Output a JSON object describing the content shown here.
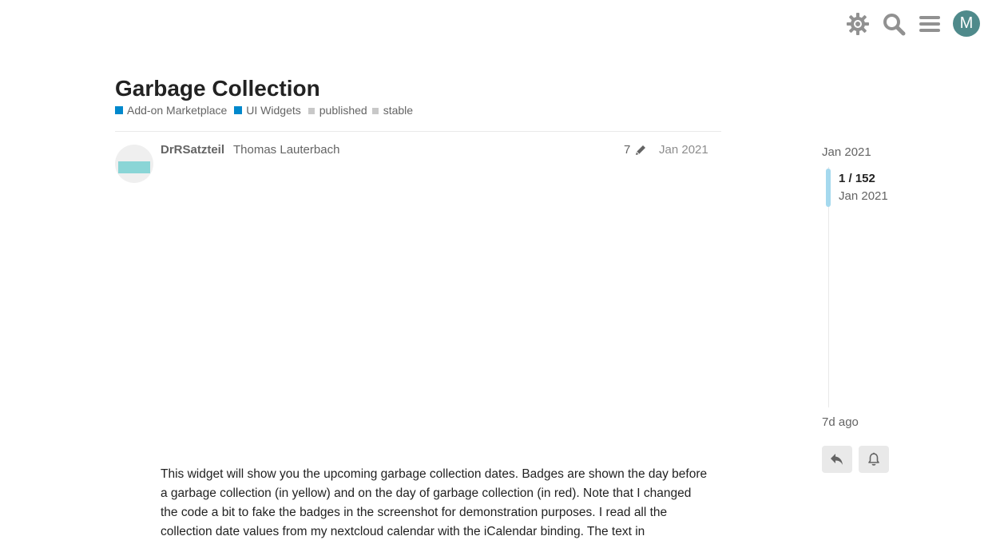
{
  "header": {
    "icons": [
      "theme-toggle-icon",
      "search-icon",
      "hamburger-menu-icon"
    ],
    "avatar_letter": "M",
    "avatar_color": "#4f8a8b"
  },
  "topic": {
    "title": "Garbage Collection",
    "categories": [
      {
        "label": "Add-on Marketplace",
        "color": "#0088cc"
      },
      {
        "label": "UI Widgets",
        "color": "#0088cc"
      }
    ],
    "tags": [
      "published",
      "stable"
    ]
  },
  "post": {
    "username": "DrRSatzteil",
    "full_name": "Thomas Lauterbach",
    "edit_count": "7",
    "date": "Jan 2021",
    "body": "This widget will show you the upcoming garbage collection dates. Badges are shown the day before a garbage collection (in yellow) and on the day of garbage collection (in red). Note that I changed the code a bit to fake the badges in the screenshot for demonstration purposes. I read all the collection date values from my nextcloud calendar with the iCalendar binding. The text in"
  },
  "timeline": {
    "start_date": "Jan 2021",
    "position": "1 / 152",
    "position_date": "Jan 2021",
    "end_label": "7d ago",
    "buttons": [
      "reply-icon",
      "notification-bell-icon"
    ]
  },
  "colors": {
    "accent": "#0088cc",
    "timeline_handle": "#a5d9ee",
    "avatar_placeholder": "#8ad5d6"
  }
}
